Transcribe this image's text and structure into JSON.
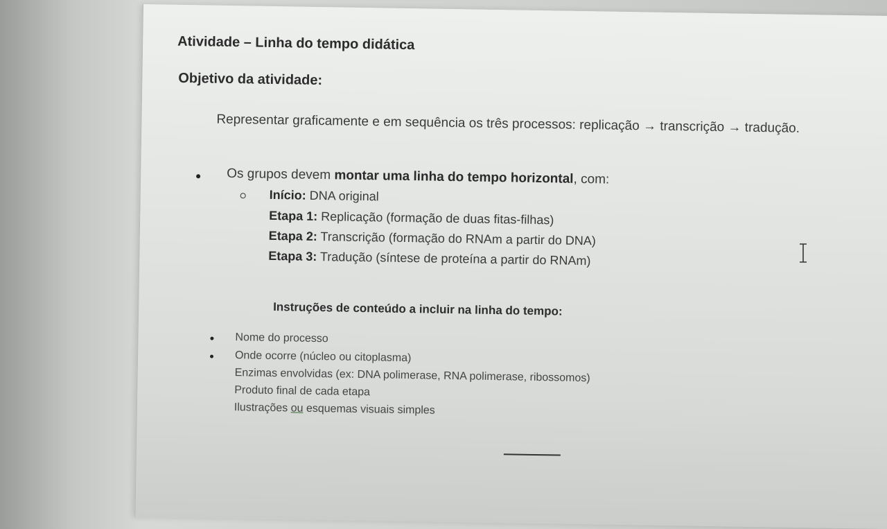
{
  "document": {
    "title": "Atividade – Linha do tempo didática",
    "objective_heading": "Objetivo da atividade:",
    "objective_text": "Representar graficamente e em sequência os três processos: replicação → transcrição → tradução.",
    "timeline_intro": {
      "prefix": "Os grupos devem ",
      "bold": "montar uma linha do tempo horizontal",
      "suffix": ", com:"
    },
    "stages": [
      {
        "label": "Início:",
        "text": " DNA original"
      },
      {
        "label": "Etapa 1:",
        "text": " Replicação (formação de duas fitas-filhas)"
      },
      {
        "label": "Etapa 2:",
        "text": " Transcrição (formação do RNAm a partir do DNA)"
      },
      {
        "label": "Etapa 3:",
        "text": " Tradução (síntese de proteína a partir do RNAm)"
      }
    ],
    "instructions_heading": "Instruções de conteúdo a incluir na linha do tempo:",
    "instructions": [
      "Nome do processo",
      "Onde ocorre (núcleo ou citoplasma)",
      "Enzimas envolvidas (ex: DNA polimerase, RNA polimerase, ribossomos)",
      "Produto final de cada etapa"
    ],
    "last_instruction": {
      "before": "Ilustrações ",
      "underlined": "ou",
      "after": " esquemas visuais simples"
    }
  },
  "icons": {
    "cursor": "text-cursor-icon"
  }
}
